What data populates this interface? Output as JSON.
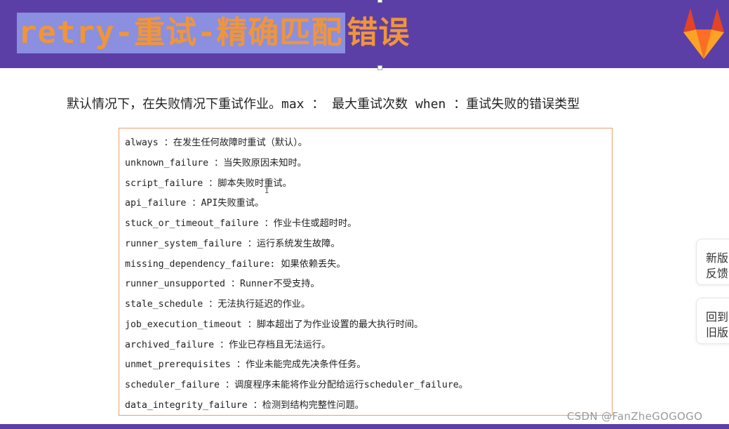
{
  "slide": {
    "title_highlighted": "retry-重试-精确匹配",
    "title_rest": "错误",
    "intro": "默认情况下，在失败情况下重试作业。max ： 最大重试次数  when ：重试失败的错误类型"
  },
  "retry_options": [
    {
      "text": "always ：在发生任何故障时重试（默认）。"
    },
    {
      "text": "unknown_failure ：当失败原因未知时。"
    },
    {
      "text": "script_failure ：脚本失败时重试。"
    },
    {
      "text": "api_failure ：API失败重试。"
    },
    {
      "text": "stuck_or_timeout_failure ：作业卡住或超时时。"
    },
    {
      "text": "runner_system_failure ：运行系统发生故障。"
    },
    {
      "text": "missing_dependency_failure: 如果依赖丢失。"
    },
    {
      "text": "runner_unsupported ：Runner不受支持。"
    },
    {
      "text": "stale_schedule ：无法执行延迟的作业。"
    },
    {
      "text": "job_execution_timeout ：脚本超出了为作业设置的最大执行时间。"
    },
    {
      "text": "archived_failure ：作业已存档且无法运行。"
    },
    {
      "text": "unmet_prerequisites ：作业未能完成先决条件任务。"
    },
    {
      "text": "scheduler_failure ：调度程序未能将作业分配给运行scheduler_failure。"
    },
    {
      "text": "data_integrity_failure ：检测到结构完整性问题。"
    }
  ],
  "side_buttons": {
    "new_version": {
      "line1": "新版",
      "line2": "反馈"
    },
    "old_version": {
      "line1": "回到",
      "line2": "旧版"
    }
  },
  "watermark": "CSDN @FanZheGOGOGO",
  "colors": {
    "header": "#5b3fa6",
    "title_text": "#f0953a",
    "selection": "#8a8fe0",
    "box_border": "#e8a070"
  },
  "icons": {
    "logo": "gitlab-fox-icon"
  }
}
